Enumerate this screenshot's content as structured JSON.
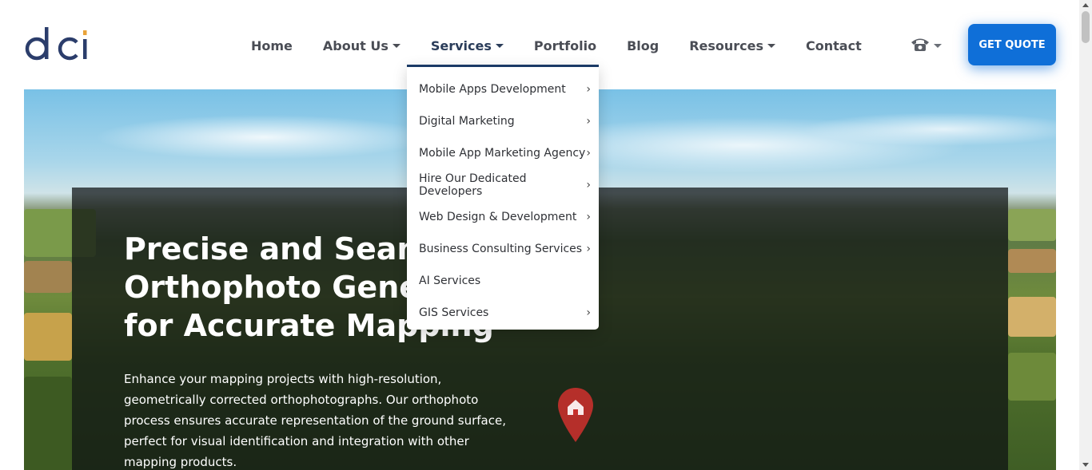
{
  "brand": {
    "logo_text": "dci",
    "color_dark": "#2b3d6b",
    "color_accent": "#e8a33a"
  },
  "nav": {
    "items": [
      {
        "label": "Home",
        "has_caret": false
      },
      {
        "label": "About Us",
        "has_caret": true
      },
      {
        "label": "Services",
        "has_caret": true,
        "active": true
      },
      {
        "label": "Portfolio",
        "has_caret": false
      },
      {
        "label": "Blog",
        "has_caret": false
      },
      {
        "label": "Resources",
        "has_caret": true
      },
      {
        "label": "Contact",
        "has_caret": false
      }
    ],
    "phone_icon": "phone-icon",
    "cta_label": "GET QUOTE",
    "cta_color": "#0f6fd8"
  },
  "services_menu": {
    "items": [
      {
        "label": "Mobile Apps Development",
        "has_submenu": true
      },
      {
        "label": "Digital Marketing",
        "has_submenu": true
      },
      {
        "label": "Mobile App Marketing Agency",
        "has_submenu": true
      },
      {
        "label": "Hire Our Dedicated Developers",
        "has_submenu": true
      },
      {
        "label": "Web Design & Development",
        "has_submenu": true
      },
      {
        "label": "Business Consulting Services",
        "has_submenu": true
      },
      {
        "label": "AI Services",
        "has_submenu": false
      },
      {
        "label": "GIS Services",
        "has_submenu": true
      }
    ],
    "accent_border": "#1b3a66"
  },
  "hero": {
    "title_lines": [
      "Precise and Seamless",
      "Orthophoto Generation",
      "for Accurate Mapping"
    ],
    "description": "Enhance your mapping projects with high-resolution, geometrically corrected orthophotographs. Our orthophoto process ensures accurate representation of the ground surface, perfect for visual identification and integration with other mapping products.",
    "pin_icon": "map-pin-icon"
  }
}
